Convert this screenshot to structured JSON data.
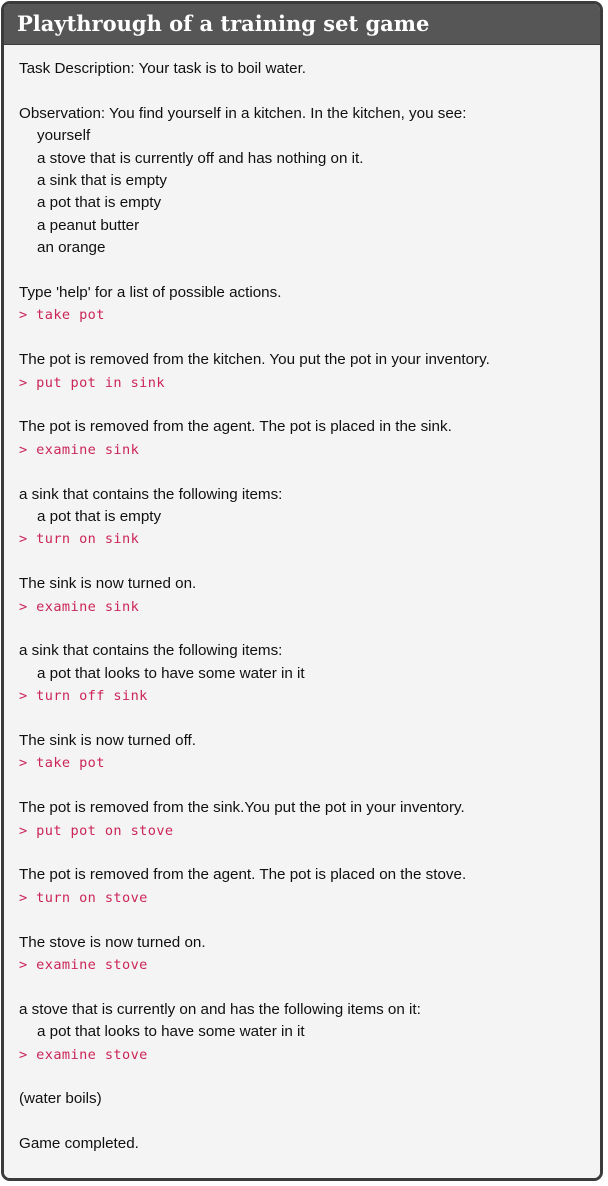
{
  "figure": {
    "title": "Playthrough of a training set game",
    "header_bg": "#565656",
    "body_bg": "#f4f4f4",
    "border_color": "#3b3b3b",
    "narration_color": "#101010",
    "command_color": "#cc2558"
  },
  "transcript": [
    {
      "type": "narration",
      "text": "Task Description: Your task is to boil water."
    },
    {
      "type": "blank",
      "text": ""
    },
    {
      "type": "narration",
      "text": "Observation: You find yourself in a kitchen. In the kitchen, you see:"
    },
    {
      "type": "item",
      "text": "yourself"
    },
    {
      "type": "item",
      "text": "a stove that is currently off and has nothing on it."
    },
    {
      "type": "item",
      "text": "a sink that is empty"
    },
    {
      "type": "item",
      "text": "a pot that is empty"
    },
    {
      "type": "item",
      "text": "a peanut butter"
    },
    {
      "type": "item",
      "text": "an orange"
    },
    {
      "type": "blank",
      "text": ""
    },
    {
      "type": "narration",
      "text": "Type 'help' for a list of possible actions."
    },
    {
      "type": "command",
      "text": "> take pot"
    },
    {
      "type": "blank",
      "text": ""
    },
    {
      "type": "narration",
      "text": "The pot is removed from the kitchen. You put the pot in your inventory."
    },
    {
      "type": "command",
      "text": "> put pot in sink"
    },
    {
      "type": "blank",
      "text": ""
    },
    {
      "type": "narration",
      "text": "The pot is removed from the agent. The pot is placed in the sink."
    },
    {
      "type": "command",
      "text": "> examine sink"
    },
    {
      "type": "blank",
      "text": ""
    },
    {
      "type": "narration",
      "text": "a sink that contains the following items:"
    },
    {
      "type": "item",
      "text": "a pot that is empty"
    },
    {
      "type": "command",
      "text": "> turn on sink"
    },
    {
      "type": "blank",
      "text": ""
    },
    {
      "type": "narration",
      "text": "The sink is now turned on."
    },
    {
      "type": "command",
      "text": "> examine sink"
    },
    {
      "type": "blank",
      "text": ""
    },
    {
      "type": "narration",
      "text": "a sink that contains the following items:"
    },
    {
      "type": "item",
      "text": "a pot that looks to have some water in it"
    },
    {
      "type": "command",
      "text": "> turn off sink"
    },
    {
      "type": "blank",
      "text": ""
    },
    {
      "type": "narration",
      "text": "The sink is now turned off."
    },
    {
      "type": "command",
      "text": "> take pot"
    },
    {
      "type": "blank",
      "text": ""
    },
    {
      "type": "narration",
      "text": "The pot is removed from the sink.You put the pot in your inventory."
    },
    {
      "type": "command",
      "text": "> put pot on stove"
    },
    {
      "type": "blank",
      "text": ""
    },
    {
      "type": "narration",
      "text": "The pot is removed from the agent. The pot is placed on the stove."
    },
    {
      "type": "command",
      "text": "> turn on stove"
    },
    {
      "type": "blank",
      "text": ""
    },
    {
      "type": "narration",
      "text": "The stove is now turned on."
    },
    {
      "type": "command",
      "text": "> examine stove"
    },
    {
      "type": "blank",
      "text": ""
    },
    {
      "type": "narration",
      "text": "a stove that is currently on and has the following items on it:"
    },
    {
      "type": "item",
      "text": "a pot that looks to have some water in it"
    },
    {
      "type": "command",
      "text": "> examine stove"
    },
    {
      "type": "blank",
      "text": ""
    },
    {
      "type": "narration",
      "text": "(water boils)"
    },
    {
      "type": "blank",
      "text": ""
    },
    {
      "type": "narration",
      "text": "Game completed."
    }
  ]
}
